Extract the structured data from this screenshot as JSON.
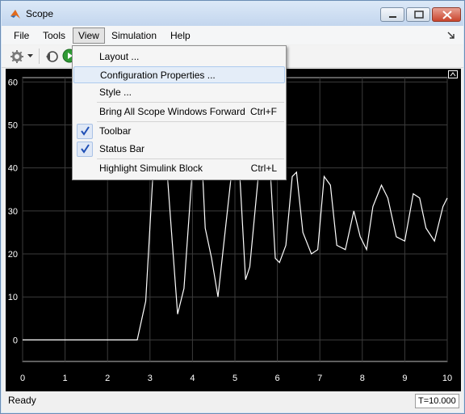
{
  "window": {
    "title": "Scope"
  },
  "menubar": {
    "items": [
      "File",
      "Tools",
      "View",
      "Simulation",
      "Help"
    ]
  },
  "view_menu": {
    "items": [
      {
        "label": "Layout ...",
        "shortcut": "",
        "checked": false
      },
      {
        "label": "Configuration Properties ...",
        "shortcut": "",
        "checked": false
      },
      {
        "label": "Style ...",
        "shortcut": "",
        "checked": false
      },
      {
        "label": "Bring All Scope Windows Forward",
        "shortcut": "Ctrl+F",
        "checked": false
      },
      {
        "label": "Toolbar",
        "shortcut": "",
        "checked": true
      },
      {
        "label": "Status Bar",
        "shortcut": "",
        "checked": true
      },
      {
        "label": "Highlight Simulink Block",
        "shortcut": "Ctrl+L",
        "checked": false
      }
    ]
  },
  "status": {
    "text": "Ready",
    "time": "T=10.000"
  },
  "chart_data": {
    "type": "line",
    "xlim": [
      0,
      10
    ],
    "ylim": [
      -5,
      61
    ],
    "x_ticks": [
      "0",
      "1",
      "2",
      "3",
      "4",
      "5",
      "6",
      "7",
      "8",
      "9",
      "10"
    ],
    "y_ticks": [
      "0",
      "10",
      "20",
      "30",
      "40",
      "50",
      "60"
    ],
    "grid": true,
    "line_color": "#ffffff",
    "background": "#000000",
    "series": [
      {
        "x": [
          0,
          2.7,
          2.9,
          3.1,
          3.3,
          3.5,
          3.65,
          3.8,
          4.0,
          4.2,
          4.3,
          4.45,
          4.6,
          4.8,
          5.0,
          5.05,
          5.25,
          5.35,
          5.55,
          5.8,
          5.95,
          6.05,
          6.2,
          6.35,
          6.45,
          6.6,
          6.8,
          6.95,
          7.1,
          7.25,
          7.4,
          7.6,
          7.8,
          7.95,
          8.1,
          8.25,
          8.45,
          8.6,
          8.8,
          9.0,
          9.2,
          9.35,
          9.5,
          9.7,
          9.9,
          10.0
        ],
        "y": [
          0,
          0,
          9,
          44,
          53,
          26,
          6,
          12,
          40,
          47,
          26,
          19,
          10,
          28,
          46,
          50,
          14,
          17,
          38,
          45,
          19,
          18,
          22,
          38,
          39,
          25,
          20,
          21,
          38,
          36,
          22,
          21,
          30,
          24,
          21,
          31,
          36,
          33,
          24,
          23,
          34,
          33,
          26,
          23,
          31,
          33
        ]
      }
    ]
  }
}
